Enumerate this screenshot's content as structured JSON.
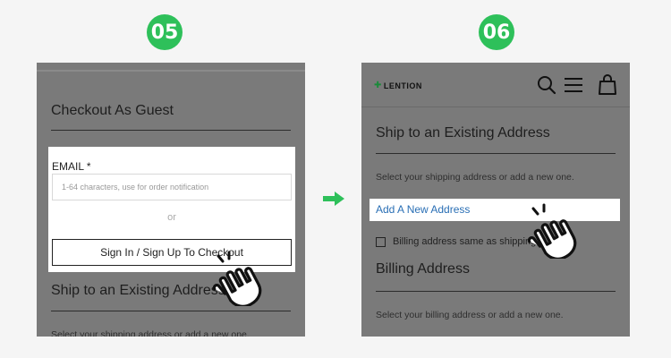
{
  "steps": {
    "left": "05",
    "right": "06"
  },
  "panel1": {
    "guest_title": "Checkout As Guest",
    "email_label": "EMAIL *",
    "email_placeholder": "1-64 characters, use for order notification",
    "or_text": "or",
    "signin_button": "Sign In / Sign Up To Checkout",
    "ship_title": "Ship to an Existing Address",
    "ship_subtitle": "Select your shipping address or add a new one."
  },
  "panel2": {
    "logo_text": "LENTION",
    "ship_title": "Ship to an Existing Address",
    "ship_subtitle": "Select your shipping address or add a new one.",
    "add_new_link": "Add A New Address",
    "billing_same_label": "Billing address same as shipping",
    "billing_title": "Billing Address",
    "billing_subtitle": "Select your billing address or add a new one."
  },
  "colors": {
    "badge": "#2ec05a",
    "arrow": "#2ec05a",
    "overlay": "#7a7a7a",
    "link": "#2a6fb5"
  },
  "icons": [
    "search-icon",
    "menu-icon",
    "cart-icon",
    "pointing-hand-icon",
    "arrow-right-icon",
    "lention-logo-icon"
  ]
}
